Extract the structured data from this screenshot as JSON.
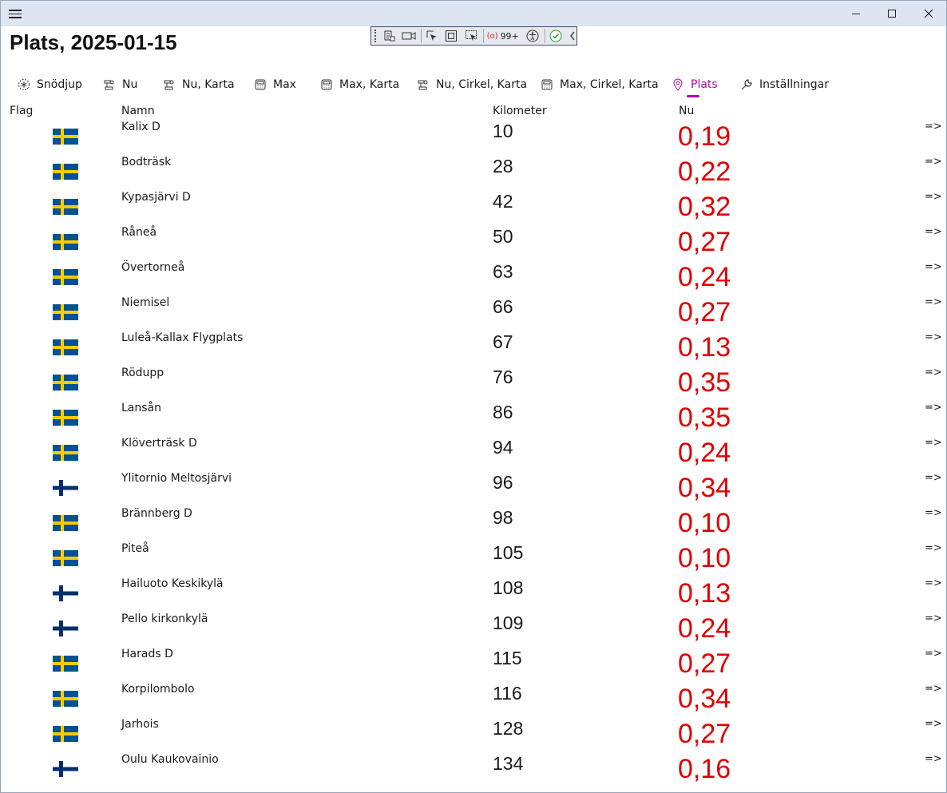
{
  "window": {
    "title": "Plats, 2025-01-15"
  },
  "devbar": {
    "count": "99+"
  },
  "tabs": [
    {
      "label": "Snödjup"
    },
    {
      "label": "Nu"
    },
    {
      "label": "Nu, Karta"
    },
    {
      "label": "Max"
    },
    {
      "label": "Max, Karta"
    },
    {
      "label": "Nu, Cirkel, Karta"
    },
    {
      "label": "Max, Cirkel, Karta"
    },
    {
      "label": "Plats"
    },
    {
      "label": "Inställningar"
    }
  ],
  "table": {
    "headers": {
      "flag": "Flag",
      "name": "Namn",
      "km": "Kilometer",
      "nu": "Nu"
    },
    "rows": [
      {
        "flag": "se",
        "name": "Kalix D",
        "km": "10",
        "nu": "0,19",
        "arrow": "=>"
      },
      {
        "flag": "se",
        "name": "Bodträsk",
        "km": "28",
        "nu": "0,22",
        "arrow": "=>"
      },
      {
        "flag": "se",
        "name": "Kypasjärvi D",
        "km": "42",
        "nu": "0,32",
        "arrow": "=>"
      },
      {
        "flag": "se",
        "name": "Råneå",
        "km": "50",
        "nu": "0,27",
        "arrow": "=>"
      },
      {
        "flag": "se",
        "name": "Övertorneå",
        "km": "63",
        "nu": "0,24",
        "arrow": "=>"
      },
      {
        "flag": "se",
        "name": "Niemisel",
        "km": "66",
        "nu": "0,27",
        "arrow": "=>"
      },
      {
        "flag": "se",
        "name": "Luleå-Kallax Flygplats",
        "km": "67",
        "nu": "0,13",
        "arrow": "=>"
      },
      {
        "flag": "se",
        "name": "Rödupp",
        "km": "76",
        "nu": "0,35",
        "arrow": "=>"
      },
      {
        "flag": "se",
        "name": "Lansån",
        "km": "86",
        "nu": "0,35",
        "arrow": "=>"
      },
      {
        "flag": "se",
        "name": "Klöverträsk D",
        "km": "94",
        "nu": "0,24",
        "arrow": "=>"
      },
      {
        "flag": "fi",
        "name": "Ylitornio Meltosjärvi",
        "km": "96",
        "nu": "0,34",
        "arrow": "=>"
      },
      {
        "flag": "se",
        "name": "Brännberg D",
        "km": "98",
        "nu": "0,10",
        "arrow": "=>"
      },
      {
        "flag": "se",
        "name": "Piteå",
        "km": "105",
        "nu": "0,10",
        "arrow": "=>"
      },
      {
        "flag": "fi",
        "name": "Hailuoto Keskikylä",
        "km": "108",
        "nu": "0,13",
        "arrow": "=>"
      },
      {
        "flag": "fi",
        "name": "Pello kirkonkylä",
        "km": "109",
        "nu": "0,24",
        "arrow": "=>"
      },
      {
        "flag": "se",
        "name": "Harads D",
        "km": "115",
        "nu": "0,27",
        "arrow": "=>"
      },
      {
        "flag": "se",
        "name": "Korpilombolo",
        "km": "116",
        "nu": "0,34",
        "arrow": "=>"
      },
      {
        "flag": "se",
        "name": "Jarhois",
        "km": "128",
        "nu": "0,27",
        "arrow": "=>"
      },
      {
        "flag": "fi",
        "name": "Oulu Kaukovainio",
        "km": "134",
        "nu": "0,16",
        "arrow": "=>"
      }
    ]
  },
  "colors": {
    "accent": "#b00aa6",
    "value": "#e00000",
    "sweden_blue": "#005293",
    "sweden_yellow": "#fecb00",
    "finland_blue": "#002f6c"
  }
}
